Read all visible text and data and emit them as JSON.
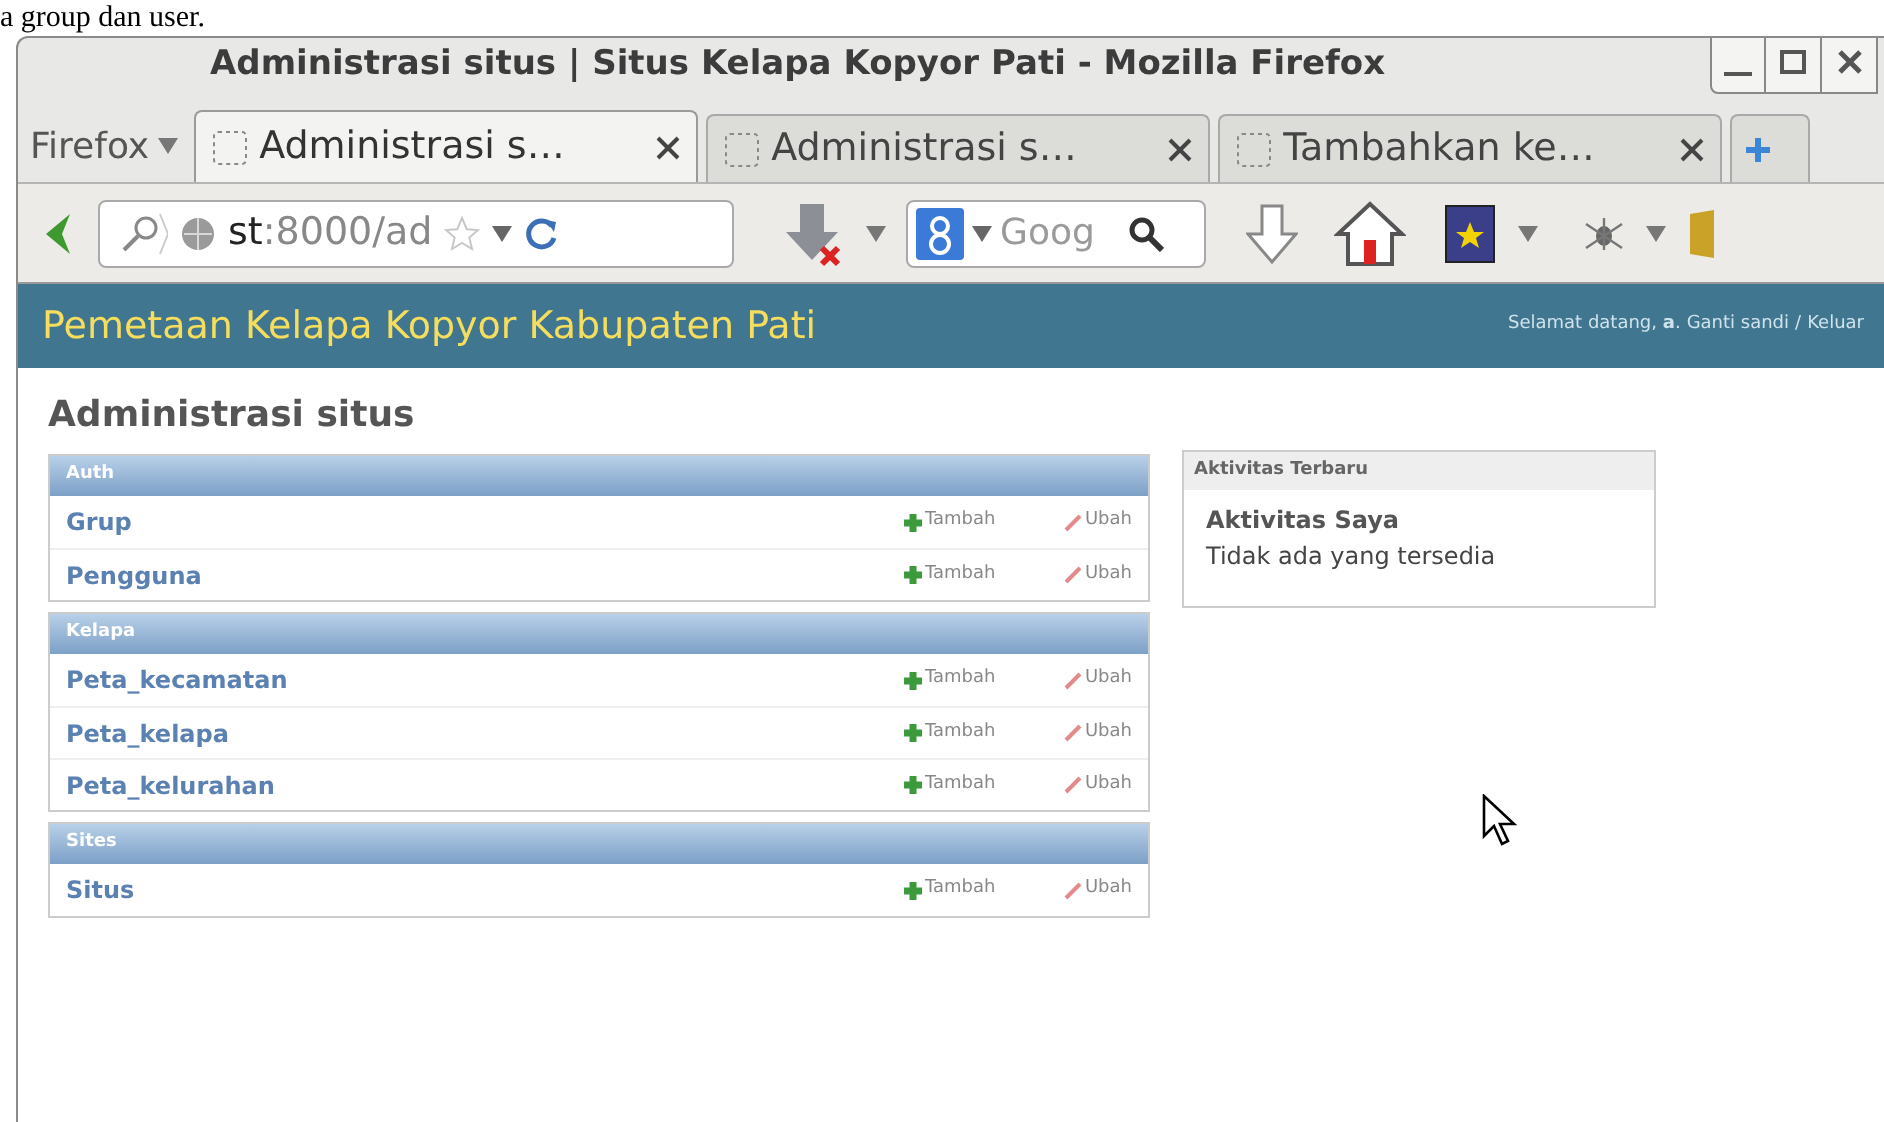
{
  "caption_fragment": "a group dan user.",
  "window": {
    "title": "Administrasi situs | Situs Kelapa Kopyor Pati - Mozilla Firefox"
  },
  "firefox_menu": {
    "label": "Firefox"
  },
  "tabs": [
    {
      "label": "Administrasi s…",
      "selected": true
    },
    {
      "label": "Administrasi s…",
      "selected": false
    },
    {
      "label": "Tambahkan ke…",
      "selected": false
    }
  ],
  "address_bar": {
    "host": "st",
    "path": ":8000/ad"
  },
  "search_field": {
    "placeholder": "Goog"
  },
  "header": {
    "site_name": "Pemetaan Kelapa Kopyor Kabupaten Pati",
    "welcome": "Selamat datang, **a**.",
    "links": [
      "Ganti sandi",
      "Keluar"
    ],
    "separator": "/"
  },
  "page_title": "Administrasi situs",
  "modules": [
    {
      "caption": "Auth",
      "models": [
        {
          "name": "Grup",
          "add": "Tambah",
          "change": "Ubah"
        },
        {
          "name": "Pengguna",
          "add": "Tambah",
          "change": "Ubah"
        }
      ]
    },
    {
      "caption": "Kelapa",
      "models": [
        {
          "name": "Peta_kecamatan",
          "add": "Tambah",
          "change": "Ubah"
        },
        {
          "name": "Peta_kelapa",
          "add": "Tambah",
          "change": "Ubah"
        },
        {
          "name": "Peta_kelurahan",
          "add": "Tambah",
          "change": "Ubah"
        }
      ]
    },
    {
      "caption": "Sites",
      "models": [
        {
          "name": "Situs",
          "add": "Tambah",
          "change": "Ubah"
        }
      ]
    }
  ],
  "recent_actions": {
    "caption": "Aktivitas Terbaru",
    "heading": "Aktivitas Saya",
    "empty": "Tidak ada yang tersedia"
  }
}
